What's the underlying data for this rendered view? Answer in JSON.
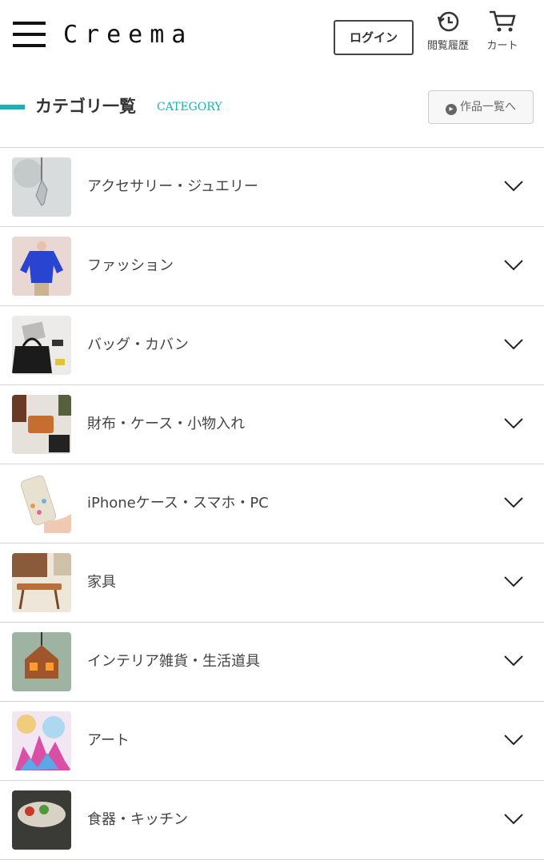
{
  "header": {
    "logo": "Creema",
    "login_label": "ログイン",
    "history_label": "閲覧履歴",
    "cart_label": "カート"
  },
  "category_section": {
    "title": "カテゴリ一覧",
    "subtitle": "CATEGORY",
    "all_works_label": "作品一覧へ",
    "accent_color": "#18b2b4"
  },
  "categories": [
    {
      "label": "アクセサリー・ジュエリー",
      "thumb": "crystal-pendant"
    },
    {
      "label": "ファッション",
      "thumb": "blue-blouse"
    },
    {
      "label": "バッグ・カバン",
      "thumb": "black-bag"
    },
    {
      "label": "財布・ケース・小物入れ",
      "thumb": "leather-wallets"
    },
    {
      "label": "iPhoneケース・スマホ・PC",
      "thumb": "phone-case"
    },
    {
      "label": "家具",
      "thumb": "wooden-table"
    },
    {
      "label": "インテリア雑貨・生活道具",
      "thumb": "house-lamp"
    },
    {
      "label": "アート",
      "thumb": "colorful-art"
    },
    {
      "label": "食器・キッチン",
      "thumb": "kitchen-plate"
    }
  ]
}
